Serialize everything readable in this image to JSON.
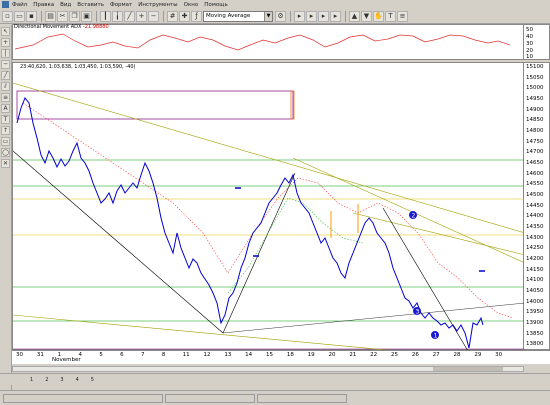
{
  "menu": [
    "Файл",
    "Правка",
    "Вид",
    "Вставить",
    "Формат",
    "Инструменты",
    "Окно",
    "Помощь"
  ],
  "toolbar": {
    "indicator_select": "Moving Average"
  },
  "oscillator": {
    "title": "Directional Movement ADX",
    "value": "-21.98880",
    "scale": [
      "50",
      "40",
      "30",
      "20",
      "10"
    ]
  },
  "main": {
    "ohlc": "23:40,620, 1:03,638, 1:03,450, 1:03,590, -40)",
    "price_labels": [
      "15100",
      "15050",
      "15000",
      "14950",
      "14900",
      "14850",
      "14800",
      "14750",
      "14700",
      "14650",
      "14600",
      "14550",
      "14500",
      "14450",
      "14400",
      "14350",
      "14300",
      "14250",
      "14200",
      "14150",
      "14100",
      "14050",
      "14000",
      "13950",
      "13900",
      "13850",
      "13800"
    ],
    "annotations": [
      "1",
      "2",
      "3"
    ]
  },
  "time_axis": {
    "labels": [
      "30",
      "31",
      "1",
      "4",
      "5",
      "6",
      "7",
      "8",
      "11",
      "12",
      "13",
      "14",
      "15",
      "18",
      "19",
      "20",
      "21",
      "22",
      "25",
      "26",
      "27",
      "28",
      "29",
      "30"
    ],
    "month": "November"
  },
  "tabs": [
    "1",
    "2",
    "3",
    "4",
    "5"
  ],
  "status": [
    "",
    "",
    ""
  ],
  "colors": {
    "bars": "#0000d0",
    "ma_red": "#ff4040",
    "ma_green": "#30c030",
    "trend_olive": "#a0a000",
    "trend_black": "#000000",
    "level_green": "#00a000",
    "level_orange": "#ff9900",
    "level_purple": "#800080",
    "osc_line": "#e03030"
  }
}
